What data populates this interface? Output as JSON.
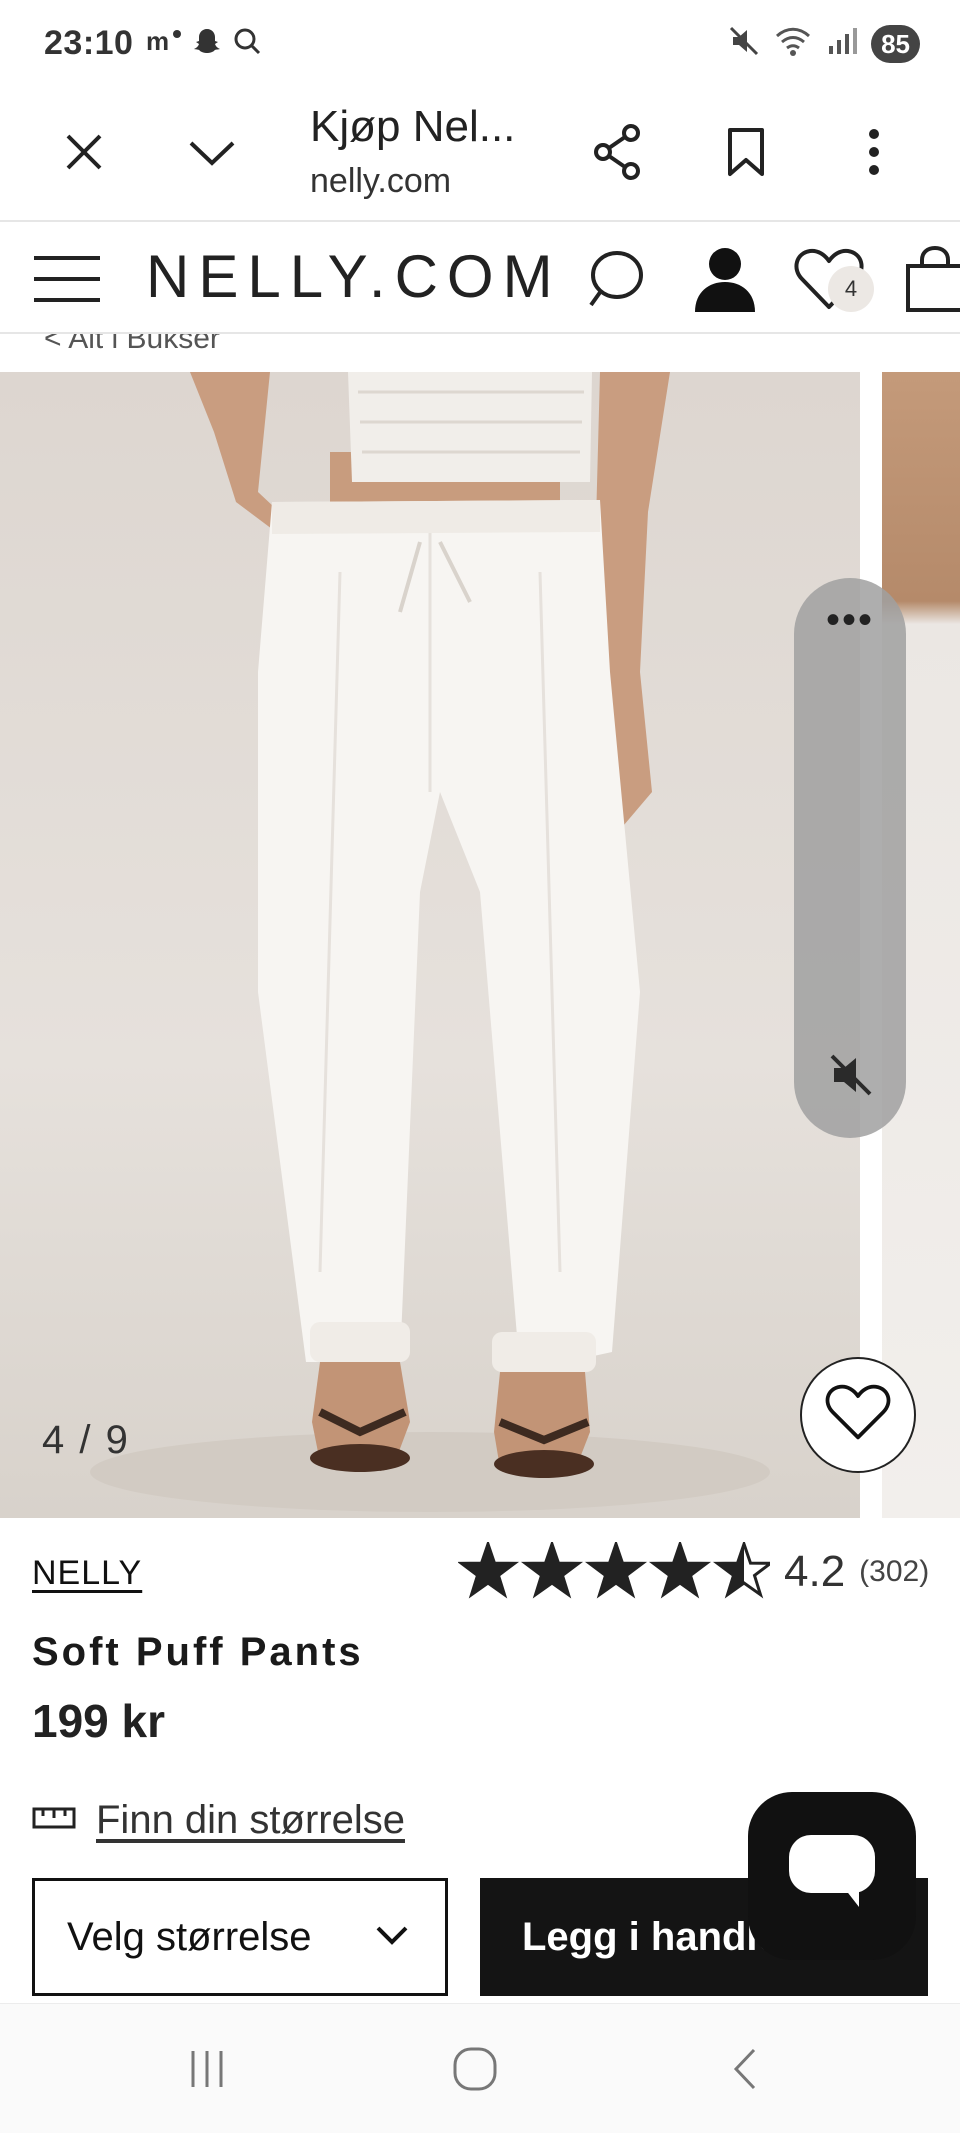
{
  "status_bar": {
    "time": "23:10",
    "left_icons": [
      "meta-icon",
      "snapchat-icon",
      "search-icon"
    ],
    "right_icons": [
      "mute-icon",
      "wifi-icon",
      "signal-icon"
    ],
    "battery": "85"
  },
  "browser": {
    "page_title": "Kjøp Nel...",
    "url": "nelly.com",
    "buttons": [
      "close-icon",
      "chevron-down-icon",
      "share-icon",
      "bookmark-icon",
      "more-vert-icon"
    ]
  },
  "site_header": {
    "logo": "NELLY.COM",
    "wishlist_count": "4"
  },
  "breadcrumb": "< Alt i Bukser",
  "gallery": {
    "counter": "4 / 9"
  },
  "product": {
    "brand": "NELLY",
    "name": "Soft Puff Pants",
    "price": "199 kr",
    "rating": {
      "value": "4.2",
      "count": "(302)",
      "stars_filled": 4.2,
      "stars_total": 5
    }
  },
  "actions": {
    "size_guide": "Finn din størrelse",
    "size_select": "Velg størrelse",
    "add_to_cart": "Legg i handlekurv"
  },
  "colors": {
    "accent": "#141414",
    "photo_bg": "#e2dcd6"
  }
}
